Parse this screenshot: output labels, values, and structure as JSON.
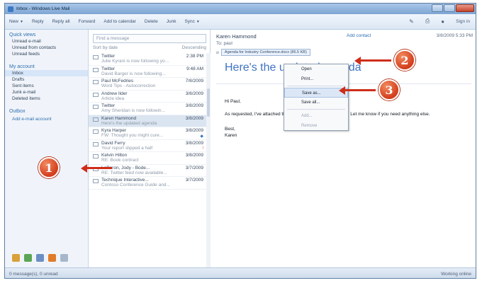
{
  "window": {
    "title": "Inbox - Windows Live Mail"
  },
  "toolbar": {
    "items": [
      "New",
      "Reply",
      "Reply all",
      "Forward",
      "Add to calendar",
      "Delete",
      "Junk",
      "Sync"
    ],
    "sign_in": "Sign in"
  },
  "sidebar": {
    "quick_views_header": "Quick views",
    "quick_views": [
      "Unread e-mail",
      "Unread from contacts",
      "Unread feeds"
    ],
    "account_header": "My account",
    "folders": [
      "Inbox",
      "Drafts",
      "Sent items",
      "Junk e-mail",
      "Deleted items"
    ],
    "outbox_header": "Outbox",
    "add_account": "Add e-mail account"
  },
  "list": {
    "search_placeholder": "Find a message",
    "sort_by": "Sort by date",
    "sort_order": "Descending",
    "messages": [
      {
        "from": "Twitter",
        "time": "2:38 PM",
        "preview": "Julie Kyrani is now following yo..."
      },
      {
        "from": "Twitter",
        "time": "9:48 AM",
        "preview": "David Barger is now following..."
      },
      {
        "from": "Paul McFedries",
        "time": "7/8/2009",
        "preview": "Word Tips - Autocorrection"
      },
      {
        "from": "Andrew Ilder",
        "time": "3/8/2009",
        "preview": "Article idea"
      },
      {
        "from": "Twitter",
        "time": "3/8/2009",
        "preview": "Amy Sheridan is now followin..."
      },
      {
        "from": "Karen Hammond",
        "time": "3/8/2009",
        "preview": "Here's the updated agenda"
      },
      {
        "from": "Kyra Harper",
        "time": "3/8/2009",
        "preview": "FW: Thought you might cure..."
      },
      {
        "from": "David Ferry",
        "time": "3/8/2009",
        "preview": "Your report slipped a half"
      },
      {
        "from": "Kelvin Hilton",
        "time": "3/8/2009",
        "preview": "RE: Book contract"
      },
      {
        "from": "LeBaron, Jody - Bode...",
        "time": "3/7/2009",
        "preview": "RE: Twitter feed now available..."
      },
      {
        "from": "Technique Interactive...",
        "time": "3/7/2009",
        "preview": "Contoso Conference Guide and..."
      }
    ]
  },
  "reading": {
    "from": "Karen Hammond",
    "to": "To: paul",
    "add_contact": "Add contact",
    "date": "3/8/2009 5:33 PM",
    "attachment": "Agenda for Industry Conference.docx (85.5 KB)",
    "subject": "Here's the updated agenda",
    "greeting": "Hi Paul,",
    "body": "As requested, I've attached the updated Conference agenda. Let me know if you need anything else.",
    "closing": "Best,",
    "signature": "Karen"
  },
  "context_menu": {
    "items": [
      "Open",
      "Print...",
      "Save as...",
      "Save all...",
      "Add...",
      "Remove"
    ]
  },
  "status": {
    "left": "0 message(s), 0 unread",
    "right": "Working online"
  },
  "callouts": [
    "1",
    "2",
    "3"
  ],
  "colors": {
    "callout": "#d33d1c",
    "subject": "#3f74c4",
    "link": "#2d6fb0"
  }
}
